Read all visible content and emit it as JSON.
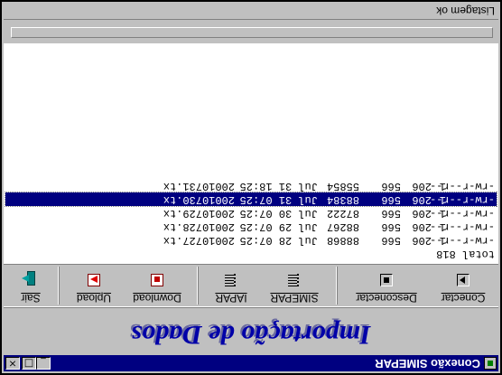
{
  "window": {
    "title": "Conexão SIMEPAR",
    "app_icon": "app-icon",
    "controls": [
      "minimize-icon",
      "maximize-icon",
      "close-icon"
    ]
  },
  "banner": {
    "text": "Importação de Dados",
    "color": "#0000a8"
  },
  "toolbar": {
    "connect": {
      "label": "Conectar",
      "icon": "play-icon"
    },
    "disconnect": {
      "label": "Desconectar",
      "icon": "stop-icon"
    },
    "simepar": {
      "label": "SIMEPAR",
      "icon": "list-icon"
    },
    "iapar": {
      "label": "IAPAR",
      "icon": "list-icon"
    },
    "download": {
      "label": "Download",
      "icon": "download-icon"
    },
    "upload": {
      "label": "Upload",
      "icon": "upload-icon"
    },
    "exit": {
      "label": "Sair",
      "icon": "exit-door-icon"
    }
  },
  "listing": {
    "total": "total 818",
    "rows": [
      {
        "perm": "-rw-r--r--",
        "links": "1",
        "uid": "206",
        "gid": "566",
        "size": "88868",
        "date": "Jul 28 07:25",
        "name": "20010727.tx",
        "selected": false
      },
      {
        "perm": "-rw-r--r--",
        "links": "1",
        "uid": "206",
        "gid": "566",
        "size": "88267",
        "date": "Jul 29 07:25",
        "name": "20010728.tx",
        "selected": false
      },
      {
        "perm": "-rw-r--r--",
        "links": "1",
        "uid": "206",
        "gid": "566",
        "size": "87222",
        "date": "Jul 30 07:25",
        "name": "20010729.tx",
        "selected": false
      },
      {
        "perm": "-rw-r--r--",
        "links": "1",
        "uid": "206",
        "gid": "566",
        "size": "88384",
        "date": "Jul 31 07:25",
        "name": "20010730.tx",
        "selected": true
      },
      {
        "perm": "-rw-r--r--",
        "links": "1",
        "uid": "206",
        "gid": "566",
        "size": "55854",
        "date": "Jul 31 18:25",
        "name": "20010731.tx",
        "selected": false
      }
    ],
    "selection_color": "#000080"
  },
  "progress": {
    "value": 0
  },
  "status": {
    "text": "Listagem ok"
  }
}
